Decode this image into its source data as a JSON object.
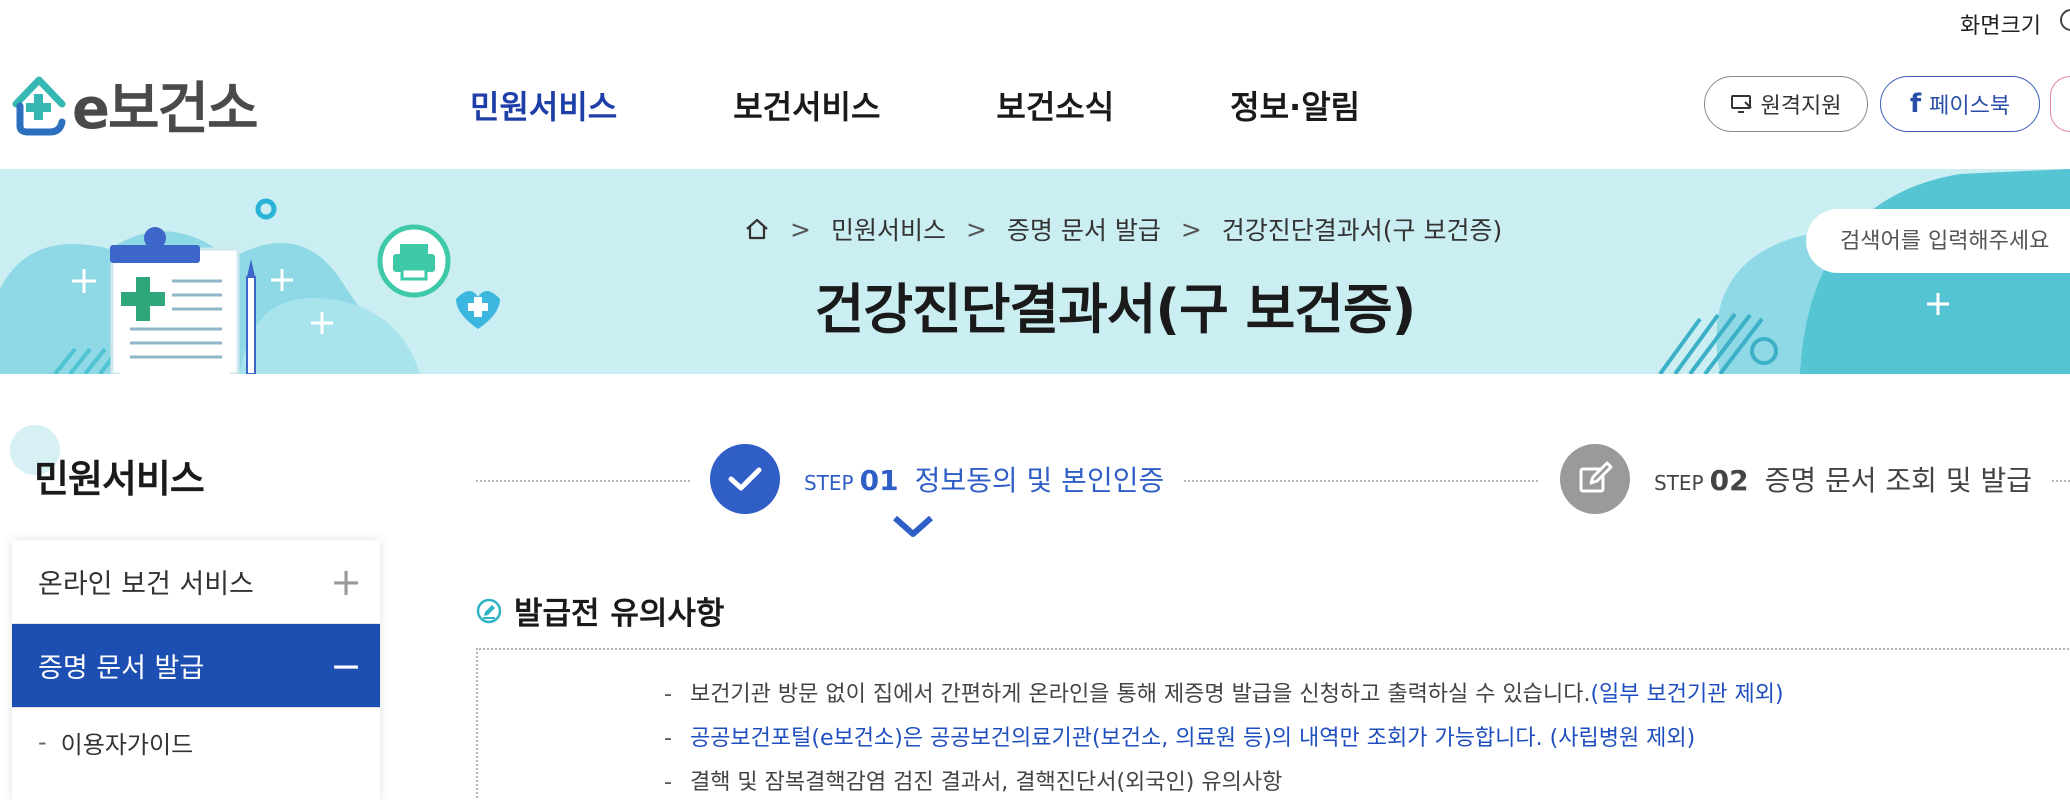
{
  "util": {
    "zoom_label": "화면크기"
  },
  "logo": {
    "text": "e보건소"
  },
  "gnb": [
    {
      "label": "민원서비스",
      "active": true
    },
    {
      "label": "보건서비스",
      "active": false
    },
    {
      "label": "보건소식",
      "active": false
    },
    {
      "label": "정보·알림",
      "active": false
    }
  ],
  "header_buttons": {
    "remote": "원격지원",
    "facebook": "페이스북"
  },
  "breadcrumb": {
    "level1": "민원서비스",
    "level2": "증명 문서 발급",
    "level3": "건강진단결과서(구 보건증)"
  },
  "page_title": "건강진단결과서(구 보건증)",
  "search": {
    "placeholder": "검색어를 입력해주세요"
  },
  "lnb": {
    "title": "민원서비스",
    "items": [
      {
        "label": "온라인 보건 서비스",
        "sign": "+"
      },
      {
        "label": "증명 문서 발급",
        "sign": "−"
      }
    ],
    "sub_items": [
      {
        "label": "이용자가이드"
      }
    ]
  },
  "steps": [
    {
      "prefix": "STEP",
      "num": "01",
      "label": "정보동의 및 본인인증"
    },
    {
      "prefix": "STEP",
      "num": "02",
      "label": "증명 문서 조회 및 발급"
    }
  ],
  "notice": {
    "title": "발급전 유의사항",
    "items": [
      {
        "text": "보건기관 방문 없이 집에서 간편하게 온라인을 통해 제증명 발급을 신청하고 출력하실 수 있습니다.",
        "highlight": "(일부 보건기관 제외)"
      },
      {
        "text": "공공보건포털(e보건소)은 공공보건의료기관(보건소, 의료원 등)의 내역만 조회가 가능합니다. (사립병원 제외)"
      },
      {
        "text": "결핵 및 잠복결핵감염 검진 결과서, 결핵진단서(외국인) 유의사항"
      }
    ]
  },
  "colors": {
    "primary": "#1d4fb3",
    "banner": "#cbeef2",
    "teal": "#3ec9c4"
  }
}
